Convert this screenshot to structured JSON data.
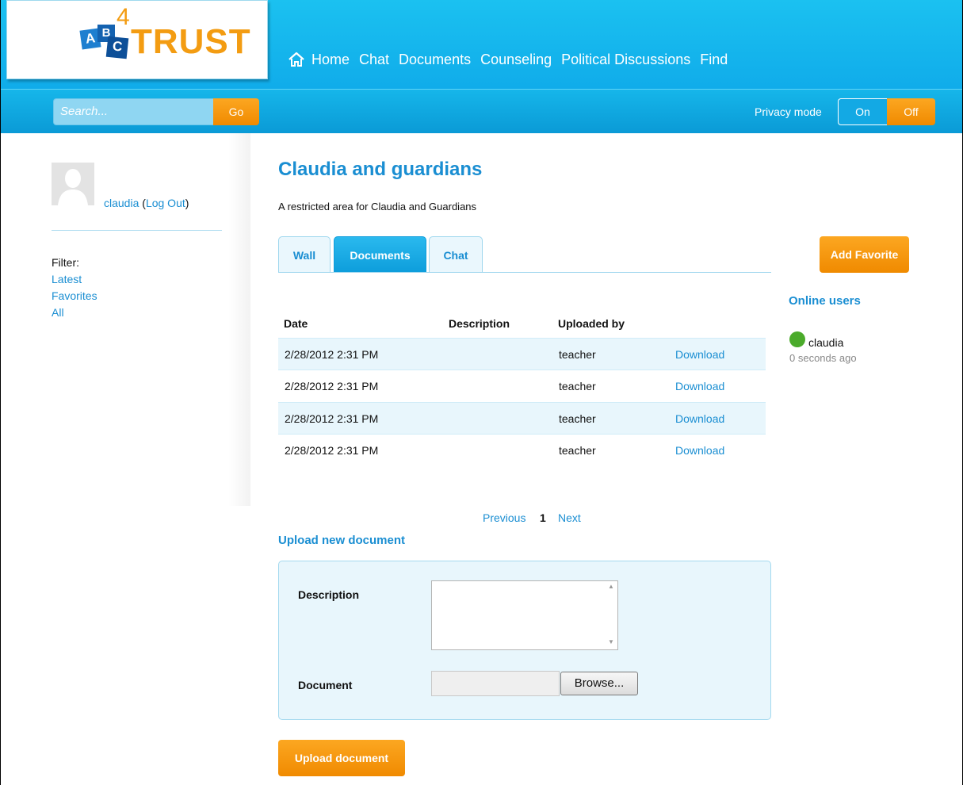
{
  "brand": {
    "logo_letters": [
      "A",
      "B",
      "C"
    ],
    "logo_superscript": "4",
    "logo_word": "TRUST"
  },
  "nav": {
    "items": [
      "Home",
      "Chat",
      "Documents",
      "Counseling",
      "Political Discussions",
      "Find"
    ],
    "home_icon": "home-icon"
  },
  "search": {
    "placeholder": "Search...",
    "button_label": "Go"
  },
  "privacy": {
    "label": "Privacy mode",
    "on_label": "On",
    "off_label": "Off",
    "selected": "Off"
  },
  "user": {
    "name": "claudia",
    "logout_label": "Log Out",
    "avatar_icon": "avatar-placeholder-icon"
  },
  "filter": {
    "label": "Filter:",
    "items": [
      "Latest",
      "Favorites",
      "All"
    ]
  },
  "page": {
    "title": "Claudia and guardians",
    "subtitle": "A restricted area for Claudia and Guardians"
  },
  "tabs": {
    "items": [
      "Wall",
      "Documents",
      "Chat"
    ],
    "active": "Documents"
  },
  "documents": {
    "columns": [
      "Date",
      "Description",
      "Uploaded by"
    ],
    "rows": [
      {
        "date": "2/28/2012 2:31 PM",
        "description": "",
        "uploaded_by": "teacher",
        "action": "Download"
      },
      {
        "date": "2/28/2012 2:31 PM",
        "description": "",
        "uploaded_by": "teacher",
        "action": "Download"
      },
      {
        "date": "2/28/2012 2:31 PM",
        "description": "",
        "uploaded_by": "teacher",
        "action": "Download"
      },
      {
        "date": "2/28/2012 2:31 PM",
        "description": "",
        "uploaded_by": "teacher",
        "action": "Download"
      }
    ]
  },
  "pagination": {
    "previous": "Previous",
    "current": "1",
    "next": "Next"
  },
  "upload": {
    "title": "Upload new document",
    "description_label": "Description",
    "description_value": "",
    "document_label": "Document",
    "browse_label": "Browse...",
    "submit_label": "Upload document"
  },
  "right": {
    "favorite_label": "Add Favorite",
    "online_title": "Online users",
    "online_users": [
      {
        "name": "claudia",
        "last_seen": "0 seconds ago",
        "status_color": "#4bab2b"
      }
    ]
  },
  "colors": {
    "accent_blue": "#1a8ed2",
    "header_blue": "#10acea",
    "orange": "#f39c12",
    "online_green": "#4bab2b"
  }
}
